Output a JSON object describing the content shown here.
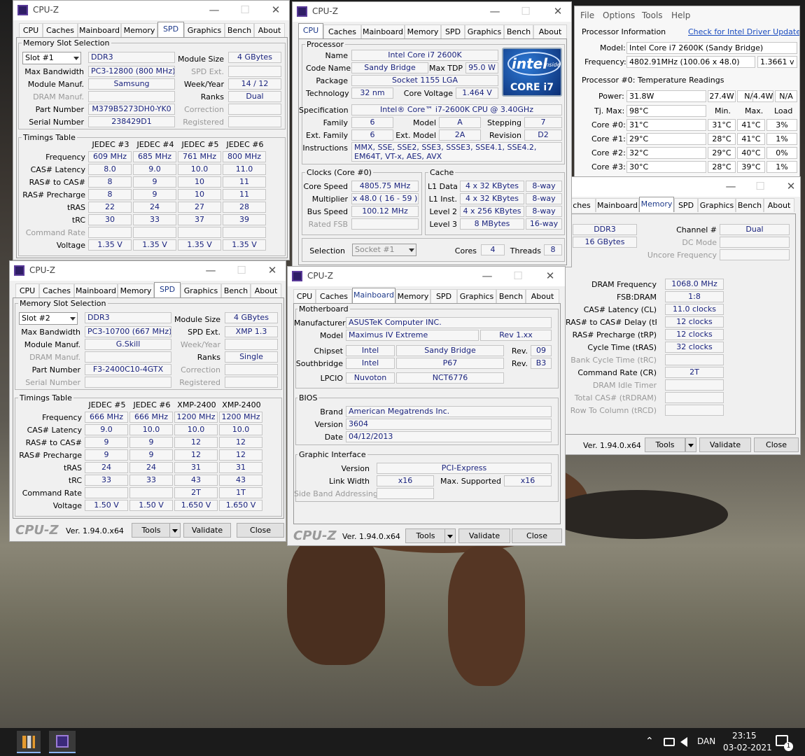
{
  "wallpaper": {
    "colors": [
      "#1c1c1c",
      "#5e5a52",
      "#8a8676"
    ]
  },
  "app": {
    "title": "CPU-Z",
    "logo": "CPU-Z",
    "version": "Ver. 1.94.0.x64",
    "tools": "Tools",
    "validate": "Validate",
    "close": "Close",
    "min": "—",
    "max": "☐",
    "x": "✕"
  },
  "tabs": {
    "cpu": "CPU",
    "caches": "Caches",
    "mainboard": "Mainboard",
    "memory": "Memory",
    "spd": "SPD",
    "graphics": "Graphics",
    "bench": "Bench",
    "about": "About",
    "caches_cut": "ches"
  },
  "spd_labels": {
    "slot_group": "Memory Slot Selection",
    "module_size": "Module Size",
    "max_bw": "Max Bandwidth",
    "spd_ext": "SPD Ext.",
    "manuf": "Module Manuf.",
    "week": "Week/Year",
    "dram": "DRAM Manuf.",
    "ranks": "Ranks",
    "part": "Part Number",
    "correction": "Correction",
    "serial": "Serial Number",
    "registered": "Registered",
    "timings": "Timings Table",
    "freq": "Frequency",
    "cas": "CAS# Latency",
    "rcd": "RAS# to CAS#",
    "rp": "RAS# Precharge",
    "tras": "tRAS",
    "trc": "tRC",
    "cr": "Command Rate",
    "volt": "Voltage"
  },
  "spd1": {
    "slot": "Slot #1",
    "type": "DDR3",
    "size": "4 GBytes",
    "bw": "PC3-12800 (800 MHz)",
    "manuf": "Samsung",
    "week": "14 / 12",
    "ranks": "Dual",
    "part": "M379B5273DH0-YK0",
    "serial": "238429D1",
    "cols": [
      "JEDEC #3",
      "JEDEC #4",
      "JEDEC #5",
      "JEDEC #6"
    ],
    "freq": [
      "609 MHz",
      "685 MHz",
      "761 MHz",
      "800 MHz"
    ],
    "cas": [
      "8.0",
      "9.0",
      "10.0",
      "11.0"
    ],
    "rcd": [
      "8",
      "9",
      "10",
      "11"
    ],
    "rp": [
      "8",
      "9",
      "10",
      "11"
    ],
    "tras": [
      "22",
      "24",
      "27",
      "28"
    ],
    "trc": [
      "30",
      "33",
      "37",
      "39"
    ],
    "volt": [
      "1.35 V",
      "1.35 V",
      "1.35 V",
      "1.35 V"
    ]
  },
  "spd2": {
    "slot": "Slot #2",
    "type": "DDR3",
    "size": "4 GBytes",
    "bw": "PC3-10700 (667 MHz)",
    "ext": "XMP 1.3",
    "manuf": "G.Skill",
    "ranks": "Single",
    "part": "F3-2400C10-4GTX",
    "cols": [
      "JEDEC #5",
      "JEDEC #6",
      "XMP-2400",
      "XMP-2400"
    ],
    "freq": [
      "666 MHz",
      "666 MHz",
      "1200 MHz",
      "1200 MHz"
    ],
    "cas": [
      "9.0",
      "10.0",
      "10.0",
      "10.0"
    ],
    "rcd": [
      "9",
      "9",
      "12",
      "12"
    ],
    "rp": [
      "9",
      "9",
      "12",
      "12"
    ],
    "tras": [
      "24",
      "24",
      "31",
      "31"
    ],
    "trc": [
      "33",
      "33",
      "43",
      "43"
    ],
    "cr": [
      "",
      "",
      "2T",
      "1T"
    ],
    "volt": [
      "1.50 V",
      "1.50 V",
      "1.650 V",
      "1.650 V"
    ]
  },
  "cpu": {
    "proc_group": "Processor",
    "l_name": "Name",
    "name": "Intel Core i7 2600K",
    "l_code": "Code Name",
    "code": "Sandy Bridge",
    "l_tdp": "Max TDP",
    "tdp": "95.0 W",
    "l_pkg": "Package",
    "pkg": "Socket 1155 LGA",
    "l_tech": "Technology",
    "tech": "32 nm",
    "l_vcore": "Core Voltage",
    "vcore": "1.464 V",
    "l_spec": "Specification",
    "spec": "Intel® Core™ i7-2600K CPU @ 3.40GHz",
    "l_family": "Family",
    "family": "6",
    "l_model": "Model",
    "model": "A",
    "l_step": "Stepping",
    "step": "7",
    "l_extfam": "Ext. Family",
    "extfam": "6",
    "l_extmod": "Ext. Model",
    "extmod": "2A",
    "l_rev": "Revision",
    "rev": "D2",
    "l_instr": "Instructions",
    "instr": "MMX, SSE, SSE2, SSE3, SSSE3, SSE4.1, SSE4.2, EM64T, VT-x, AES, AVX",
    "clocks_group": "Clocks (Core #0)",
    "l_speed": "Core Speed",
    "speed": "4805.75 MHz",
    "l_mult": "Multiplier",
    "mult": "x 48.0 ( 16 - 59 )",
    "l_bus": "Bus Speed",
    "bus": "100.12 MHz",
    "l_fsb": "Rated FSB",
    "cache_group": "Cache",
    "l_l1d": "L1 Data",
    "l1d": "4 x 32 KBytes",
    "l1d_w": "8-way",
    "l_l1i": "L1 Inst.",
    "l1i": "4 x 32 KBytes",
    "l1i_w": "8-way",
    "l_l2": "Level 2",
    "l2": "4 x 256 KBytes",
    "l2_w": "8-way",
    "l_l3": "Level 3",
    "l3": "8 MBytes",
    "l3_w": "16-way",
    "l_sel": "Selection",
    "sel": "Socket #1",
    "l_cores": "Cores",
    "cores": "4",
    "l_threads": "Threads",
    "threads": "8",
    "intel_word": "intel",
    "intel_inside": "inside",
    "intel_core": "CORE i7"
  },
  "mb": {
    "group": "Motherboard",
    "l_manuf": "Manufacturer",
    "manuf": "ASUSTeK Computer INC.",
    "l_model": "Model",
    "model": "Maximus IV Extreme",
    "rev": "Rev 1.xx",
    "l_chipset": "Chipset",
    "chipset_v": "Intel",
    "chipset": "Sandy Bridge",
    "l_rev": "Rev.",
    "chipset_rev": "09",
    "l_south": "Southbridge",
    "south_v": "Intel",
    "south": "P67",
    "south_rev": "B3",
    "l_lpcio": "LPCIO",
    "lpcio_v": "Nuvoton",
    "lpcio": "NCT6776",
    "bios_group": "BIOS",
    "l_brand": "Brand",
    "brand": "American Megatrends Inc.",
    "l_version": "Version",
    "version": "3604",
    "l_date": "Date",
    "date": "04/12/2013",
    "gi_group": "Graphic Interface",
    "l_giver": "Version",
    "giver": "PCI-Express",
    "l_lw": "Link Width",
    "lw": "x16",
    "l_ms": "Max. Supported",
    "ms": "x16",
    "l_sba": "Side Band Addressing"
  },
  "mem": {
    "type": "DDR3",
    "l_channel": "Channel #",
    "channel": "Dual",
    "size": "16 GBytes",
    "l_dc": "DC Mode",
    "l_unc": "Uncore Frequency",
    "l_dram": "DRAM Frequency",
    "dram": "1068.0 MHz",
    "l_fsb": "FSB:DRAM",
    "fsb": "1:8",
    "l_cl": "CAS# Latency (CL)",
    "cl": "11.0 clocks",
    "l_rcd": "RAS# to CAS# Delay (tRCD)",
    "rcd": "12 clocks",
    "l_rp": "RAS# Precharge (tRP)",
    "rp": "12 clocks",
    "l_tras": "Cycle Time (tRAS)",
    "tras": "32 clocks",
    "l_trc": "Bank Cycle Time (tRC)",
    "l_cr": "Command Rate (CR)",
    "cr": "2T",
    "l_idle": "DRAM Idle Timer",
    "l_rdram": "Total CAS# (tRDRAM)",
    "l_trcd": "Row To Column (tRCD)"
  },
  "hw": {
    "menu": [
      "File",
      "Options",
      "Tools",
      "Help"
    ],
    "l_info": "Processor Information",
    "link": "Check for Intel Driver Updates",
    "l_model": "Model:",
    "model": "Intel Core i7 2600K (Sandy Bridge)",
    "l_freq": "Frequency:",
    "freq": "4802.91MHz (100.06 x 48.0)",
    "volt": "1.3661 v",
    "l_temps": "Processor #0: Temperature Readings",
    "l_power": "Power:",
    "power": [
      "31.8W",
      "27.4W",
      "N/A",
      "4.4W",
      "N/A"
    ],
    "l_tj": "Tj. Max:",
    "tj": "98°C",
    "h_min": "Min.",
    "h_max": "Max.",
    "h_load": "Load",
    "cores": [
      {
        "l": "Core #0:",
        "t": "31°C",
        "min": "31°C",
        "max": "41°C",
        "load": "3%"
      },
      {
        "l": "Core #1:",
        "t": "29°C",
        "min": "28°C",
        "max": "41°C",
        "load": "1%"
      },
      {
        "l": "Core #2:",
        "t": "32°C",
        "min": "29°C",
        "max": "40°C",
        "load": "0%"
      },
      {
        "l": "Core #3:",
        "t": "30°C",
        "min": "28°C",
        "max": "39°C",
        "load": "1%"
      }
    ]
  },
  "taskbar": {
    "lang": "DAN",
    "time": "23:15",
    "date": "03-02-2021",
    "notif": "1",
    "chevron": "⌃"
  }
}
